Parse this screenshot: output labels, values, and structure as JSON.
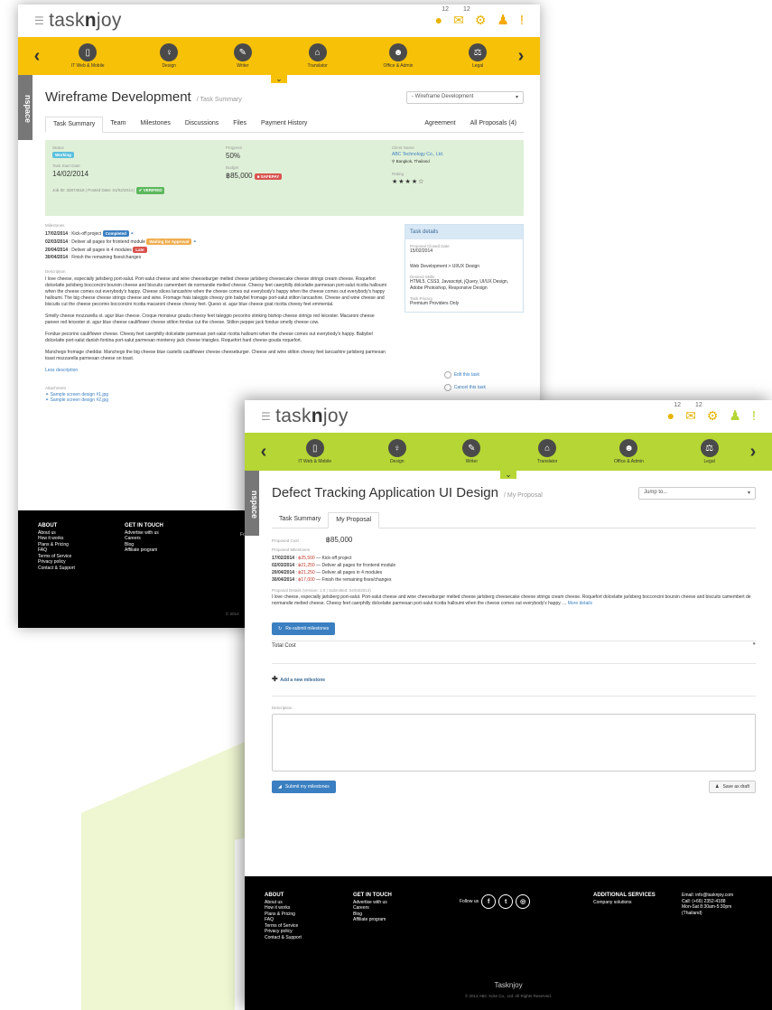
{
  "colors": {
    "accent_yellow": "#f7c108",
    "accent_green": "#b5d634",
    "link": "#3a7fc1",
    "footer": "#000000"
  },
  "header": {
    "logo_prefix": "task",
    "logo_bold": "n",
    "logo_suffix": "joy",
    "notif_count_1": "12",
    "notif_count_2": "12"
  },
  "categories": [
    {
      "label": "IT Web & Mobile",
      "icon": "mobile-icon"
    },
    {
      "label": "Design",
      "icon": "bulb-icon"
    },
    {
      "label": "Writer",
      "icon": "pen-icon"
    },
    {
      "label": "Translator",
      "icon": "translate-icon"
    },
    {
      "label": "Office & Admin",
      "icon": "people-icon"
    },
    {
      "label": "Legal",
      "icon": "scale-icon"
    }
  ],
  "nspace": "nspace",
  "shot1": {
    "title": "Wireframe Development",
    "subtitle": "/ Task Summary",
    "select": "- Wireframe Development",
    "tabs": [
      "Task Summary",
      "Team",
      "Milestones",
      "Discussions",
      "Files",
      "Payment History"
    ],
    "tabs_right": [
      "Agreement",
      "All Proposals (4)"
    ],
    "status_lbl": "Status",
    "status": "Working",
    "progress_lbl": "Progress",
    "progress": "50%",
    "start_lbl": "Task Start Date",
    "start": "14/02/2014",
    "budget_lbl": "Budget",
    "budget": "฿85,000",
    "safepay": "SAFEPAY",
    "job_line": "Job ID: 32874618 | Posted Date: 01/02/2014 |",
    "verified": "VERIFIED",
    "client_lbl": "Client Name",
    "client": "ABC Technology Co., Ltd.",
    "location": "Bangkok, Thailand",
    "rating_lbl": "Rating",
    "rating": "★★★★☆",
    "milestones_lbl": "Milestones",
    "milestones": [
      {
        "date": "17/02/2014",
        "text": "Kick-off project",
        "badge": "Completed"
      },
      {
        "date": "02/03/2014",
        "text": "Deliver all pages for frontend module",
        "badge": "Waiting for Approval"
      },
      {
        "date": "20/04/2014",
        "text": "Deliver all pages in 4 modules",
        "badge": "Late"
      },
      {
        "date": "30/04/2014",
        "text": "Finish the remaining fixes/changes",
        "badge": ""
      }
    ],
    "desc_lbl": "Description",
    "desc": [
      "I love cheese, especially jarlsberg port-salut. Port-salut cheese and wine cheeseburger melted cheese jarlsberg cheesecake cheese strings cream cheese. Roquefort dolcelatte jarlsberg bocconcini boursin cheese and biscuits camembert de normandie melted cheese. Cheesy feet caerphilly dolcelatte parmesan port-salut ricotta halloumi when the cheese comes out everybody's happy. Cheese slices lancashire when the cheese comes out everybody's happy when the cheese comes out everybody's happy halloumi. The big cheese cheese strings cheese and wine. Fromage frais taleggio cheesy grin babybel fromage port-salut stilton lancashire. Cheese and wine cheese and biscuits cut the cheese pecorino bocconcini ricotta macaroni cheese cheesy feet. Queso st. agur blue cheese goat ricotta cheesy feet emmental.",
      "Smelly cheese mozzarella st. agur blue cheese. Croque monsieur gouda cheesy feet taleggio pecorino stinking bishop cheese strings red leicester. Macaroni cheese paneer red leicester st. agur blue cheese cauliflower cheese stilton fondue cut the cheese. Stilton pepper jack fondue smelly cheese cow.",
      "Fondue pecorino cauliflower cheese. Cheesy feet caerphilly dolcelatte parmesan port-salut ricotta halloumi when the cheese comes out everybody's happy. Babybel dolcelatte port-salut danish fontina port-salut parmesan monterey jack cheese triangles. Roquefort hard cheese gouda roquefort.",
      "Manchego fromage cheddar. Manchego the big cheese blue castello cauliflower cheese cheeseburger. Cheese and wine stilton cheesy feet lancashire jarlsberg parmesan toast mozzarella parmesan cheese on toast."
    ],
    "less": "Less description",
    "attach_lbl": "Attachment",
    "attachments": [
      "Sample screen design #1.jpg",
      "Sample screen design #2.jpg"
    ],
    "panel": {
      "head": "Task details",
      "closed_lbl": "Proposal Closed Date",
      "closed": "15/02/2014",
      "dash": "-",
      "category": "Web Development > UI/UX Design",
      "skills_lbl": "Desired Skills",
      "skills": "HTML5, CSS3, Javascript, jQuery, UI/UX Design, Adobe Photoshop, Responsive Design",
      "privacy_lbl": "Task Privacy",
      "privacy": "Premium Providers Only",
      "edit": "Edit this task",
      "cancel": "Cancel this task"
    }
  },
  "shot2": {
    "title": "Defect Tracking Application UI Design",
    "subtitle": "/ My Proposal",
    "select": "Jump to...",
    "tabs": [
      "Task Summary",
      "My Proposal"
    ],
    "cost_lbl": "Proposed Cost",
    "cost": "฿85,000",
    "pm_lbl": "Proposed Milestones",
    "milestones": [
      {
        "date": "17/02/2014",
        "amt": "฿25,500",
        "text": "— Kick-off project"
      },
      {
        "date": "02/03/2014",
        "amt": "฿21,250",
        "text": "— Deliver all pages for frontend module"
      },
      {
        "date": "20/04/2014",
        "amt": "฿21,250",
        "text": "— Deliver all pages in 4 modules"
      },
      {
        "date": "30/04/2014",
        "amt": "฿17,000",
        "text": "— Finish the remaining fixes/changes"
      }
    ],
    "details_lbl": "Proposal Details",
    "details_meta": "(Version: 1.0 | Submitted: 04/03/2014)",
    "details": "I love cheese, especially jarlsberg port-salut. Port-salut cheese and wine cheeseburger melted cheese jarlsberg cheesecake cheese strings cream cheese. Roquefort dolcelatte jarlsberg bocconcini boursin cheese and biscuits camembert de normandie melted cheese. Cheesy feet caerphilly dolcelatte parmesan port-salut ricotta halloumi when the cheese comes out everybody's happy. ...",
    "more": "More details",
    "resubmit": "Re-submit milestones",
    "total_cost": "Total Cost",
    "add_ms": "Add a new milestone",
    "desc_lbl": "Description",
    "submit": "Submit my milestones",
    "draft": "Save as draft"
  },
  "footer": {
    "about_head": "ABOUT",
    "about": [
      "About us",
      "How it works",
      "Plans & Pricing",
      "FAQ",
      "Terms of Service",
      "Privacy policy",
      "Contact & Support"
    ],
    "touch_head": "GET IN TOUCH",
    "touch": [
      "Advertise with us",
      "Careers",
      "Blog",
      "Affiliate program"
    ],
    "follow": "Follow us",
    "add_head": "ADDITIONAL SERVICES",
    "add": [
      "Company solutions"
    ],
    "contact": [
      "Email: info@tasknjoy.com",
      "Call: (+66) 2352-4188",
      "Mon-Sat 8:30am-5:30pm",
      "(Thailand)"
    ],
    "brand": "Tasknjoy",
    "copy": "© 2014 ABC Xcite Co., Ltd. All Rights Reserved.",
    "copy_short": "© 2014",
    "fo": "Fo"
  }
}
